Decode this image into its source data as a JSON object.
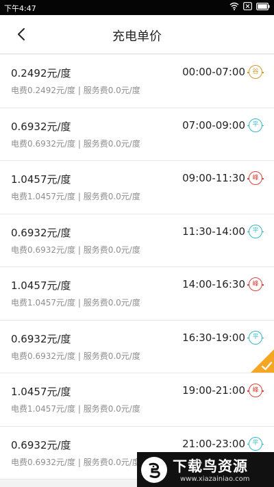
{
  "status_bar": {
    "time": "下午4:47"
  },
  "header": {
    "title": "充电单价"
  },
  "rows": [
    {
      "price": "0.2492元/度",
      "detail": "电费0.2492元/度 | 服务费0.0元/度",
      "time": "00:00-07:00",
      "tag": "谷",
      "tag_type": "valley"
    },
    {
      "price": "0.6932元/度",
      "detail": "电费0.6932元/度 | 服务费0.0元/度",
      "time": "07:00-09:00",
      "tag": "平",
      "tag_type": "flat"
    },
    {
      "price": "1.0457元/度",
      "detail": "电费1.0457元/度 | 服务费0.0元/度",
      "time": "09:00-11:30",
      "tag": "峰",
      "tag_type": "peak"
    },
    {
      "price": "0.6932元/度",
      "detail": "电费0.6932元/度 | 服务费0.0元/度",
      "time": "11:30-14:00",
      "tag": "平",
      "tag_type": "flat"
    },
    {
      "price": "1.0457元/度",
      "detail": "电费1.0457元/度 | 服务费0.0元/度",
      "time": "14:00-16:30",
      "tag": "峰",
      "tag_type": "peak"
    },
    {
      "price": "0.6932元/度",
      "detail": "电费0.6932元/度 | 服务费0.0元/度",
      "time": "16:30-19:00",
      "tag": "平",
      "tag_type": "flat",
      "selected": true
    },
    {
      "price": "1.0457元/度",
      "detail": "电费1.0457元/度 | 服务费0.0元/度",
      "time": "19:00-21:00",
      "tag": "峰",
      "tag_type": "peak"
    },
    {
      "price": "0.6932元/度",
      "detail": "电费0.6932元/度 | 服务费0.0元/度",
      "time": "21:00-23:00",
      "tag": "平",
      "tag_type": "flat"
    }
  ],
  "colors": {
    "valley": "#d19a2a",
    "flat": "#31b7c9",
    "peak": "#d9423a",
    "selected": "#f5a623"
  },
  "watermark": {
    "title": "下载鸟资源",
    "url": "www.xiazainiao.com"
  }
}
